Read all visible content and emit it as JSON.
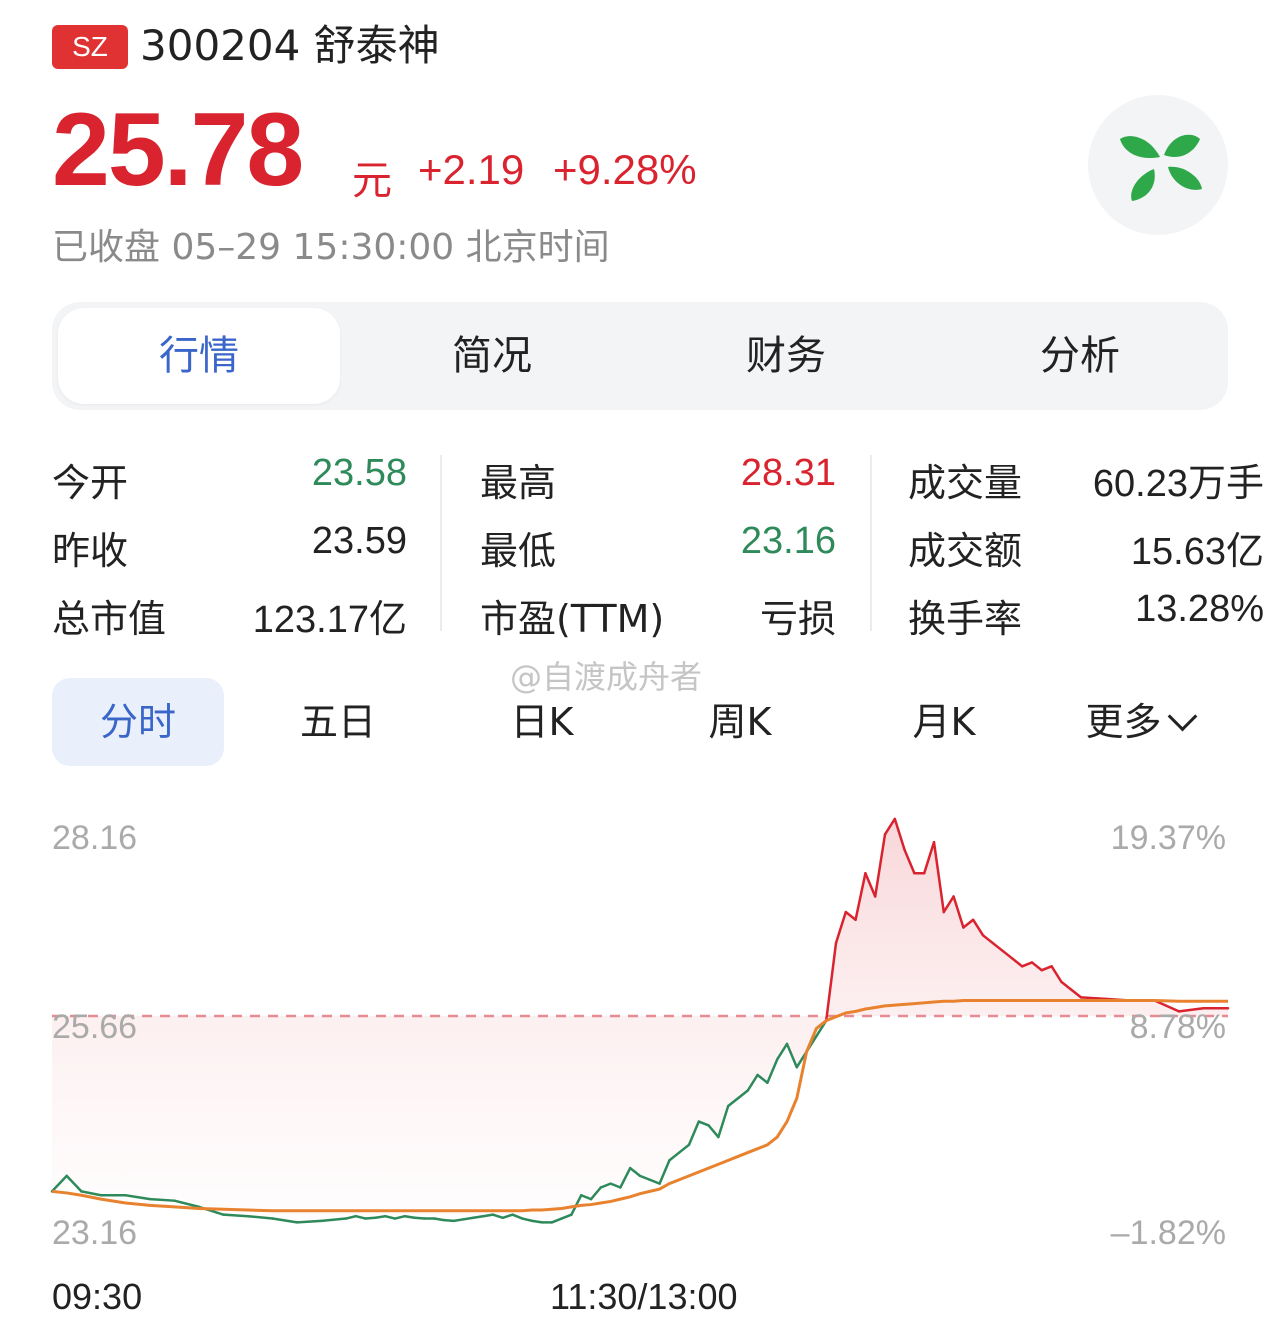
{
  "header": {
    "market": "SZ",
    "title": "300204 舒泰神",
    "price": "25.78",
    "unit": "元",
    "change": "+2.19",
    "change_pct": "+9.28%",
    "status": "已收盘 05–29 15:30:00 北京时间"
  },
  "tabs": [
    {
      "label": "行情",
      "active": true
    },
    {
      "label": "简况",
      "active": false
    },
    {
      "label": "财务",
      "active": false
    },
    {
      "label": "分析",
      "active": false
    }
  ],
  "stats": [
    {
      "label": "今开",
      "value": "23.58",
      "trend": "down"
    },
    {
      "label": "昨收",
      "value": "23.59",
      "trend": "flat"
    },
    {
      "label": "总市值",
      "value": "123.17亿",
      "trend": "flat"
    },
    {
      "label": "最高",
      "value": "28.31",
      "trend": "up"
    },
    {
      "label": "最低",
      "value": "23.16",
      "trend": "down"
    },
    {
      "label": "市盈(TTM)",
      "value": "亏损",
      "trend": "flat"
    },
    {
      "label": "成交量",
      "value": "60.23万手",
      "trend": "flat"
    },
    {
      "label": "成交额",
      "value": "15.63亿",
      "trend": "flat"
    },
    {
      "label": "换手率",
      "value": "13.28%",
      "trend": "flat"
    }
  ],
  "watermark": "@自渡成舟者",
  "period_tabs": [
    {
      "label": "分时",
      "active": true
    },
    {
      "label": "五日",
      "active": false
    },
    {
      "label": "日K",
      "active": false
    },
    {
      "label": "周K",
      "active": false
    },
    {
      "label": "月K",
      "active": false
    },
    {
      "label": "更多",
      "active": false
    }
  ],
  "colors": {
    "up": "#d9232f",
    "down": "#2e8a5a",
    "accent": "#3a66c9",
    "avg_line": "#e8822e"
  },
  "chart_data": {
    "type": "line",
    "title": "",
    "xlabel": "",
    "ylabel": "",
    "ylim": [
      23.16,
      28.16
    ],
    "y_ticks_left": [
      "28.16",
      "25.66",
      "23.16"
    ],
    "y_ticks_right": [
      "19.37%",
      "8.78%",
      "–1.82%"
    ],
    "x_ticks": [
      "09:30",
      "11:30/13:00"
    ],
    "reference_price": 25.66,
    "x": [
      0,
      3,
      6,
      10,
      15,
      20,
      25,
      30,
      35,
      40,
      45,
      50,
      55,
      60,
      62,
      64,
      66,
      68,
      70,
      72,
      74,
      76,
      78,
      80,
      82,
      84,
      86,
      88,
      90,
      92,
      94,
      96,
      98,
      100,
      102,
      104,
      106,
      108,
      110,
      112,
      114,
      116,
      118,
      120,
      122,
      124,
      126,
      128,
      130,
      132,
      134,
      136,
      138,
      140,
      142,
      144,
      146,
      148,
      150,
      152,
      154,
      156,
      158,
      160,
      162,
      164,
      166,
      168,
      170,
      172,
      174,
      176,
      178,
      180,
      182,
      184,
      186,
      188,
      190,
      192,
      194,
      196,
      198,
      200,
      202,
      204,
      206,
      208,
      210,
      215,
      220,
      225,
      230,
      235,
      240
    ],
    "series": [
      {
        "values": [
          23.4,
          23.6,
          23.4,
          23.35,
          23.35,
          23.3,
          23.28,
          23.2,
          23.1,
          23.08,
          23.05,
          23.0,
          23.02,
          23.05,
          23.08,
          23.05,
          23.06,
          23.08,
          23.05,
          23.08,
          23.06,
          23.05,
          23.05,
          23.03,
          23.02,
          23.04,
          23.06,
          23.08,
          23.1,
          23.06,
          23.1,
          23.05,
          23.02,
          23.0,
          23.0,
          23.05,
          23.1,
          23.35,
          23.3,
          23.45,
          23.5,
          23.45,
          23.7,
          23.6,
          23.55,
          23.5,
          23.8,
          23.9,
          24.0,
          24.3,
          24.25,
          24.1,
          24.5,
          24.6,
          24.7,
          24.9,
          24.8,
          25.1,
          25.3,
          25.0,
          25.2,
          25.4,
          25.6,
          26.6,
          27.0,
          26.9,
          27.5,
          27.2,
          28.0,
          28.2,
          27.8,
          27.5,
          27.5,
          27.9,
          27.0,
          27.2,
          26.8,
          26.9,
          26.7,
          26.6,
          26.5,
          26.4,
          26.3,
          26.35,
          26.25,
          26.3,
          26.1,
          26.0,
          25.9,
          25.88,
          25.86,
          25.86,
          25.72,
          25.76,
          25.76
        ],
        "name": ""
      },
      {
        "values": [
          23.4,
          23.38,
          23.35,
          23.3,
          23.25,
          23.22,
          23.2,
          23.18,
          23.17,
          23.16,
          23.15,
          23.15,
          23.15,
          23.15,
          23.15,
          23.15,
          23.15,
          23.15,
          23.15,
          23.15,
          23.15,
          23.15,
          23.15,
          23.15,
          23.15,
          23.15,
          23.15,
          23.15,
          23.15,
          23.15,
          23.15,
          23.15,
          23.16,
          23.16,
          23.17,
          23.18,
          23.2,
          23.22,
          23.23,
          23.25,
          23.27,
          23.3,
          23.33,
          23.37,
          23.4,
          23.43,
          23.5,
          23.55,
          23.6,
          23.65,
          23.7,
          23.75,
          23.8,
          23.85,
          23.9,
          23.95,
          24.0,
          24.1,
          24.3,
          24.6,
          25.2,
          25.5,
          25.6,
          25.65,
          25.7,
          25.72,
          25.75,
          25.77,
          25.79,
          25.8,
          25.81,
          25.82,
          25.83,
          25.84,
          25.85,
          25.85,
          25.86,
          25.86,
          25.86,
          25.86,
          25.86,
          25.86,
          25.86,
          25.86,
          25.86,
          25.86,
          25.86,
          25.86,
          25.86,
          25.86,
          25.86,
          25.86,
          25.85,
          25.85,
          25.85
        ],
        "name": ""
      }
    ]
  }
}
